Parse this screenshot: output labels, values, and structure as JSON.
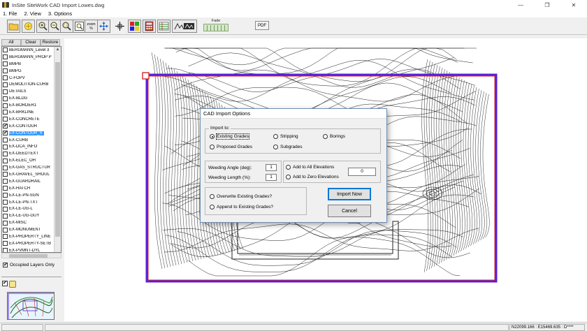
{
  "app": {
    "title": "InSite SiteWork CAD Import   Lowes.dwg",
    "window_controls": [
      "—",
      "❐",
      "✕"
    ]
  },
  "menu": [
    "1. File",
    "2. View",
    "3. Options"
  ],
  "toolbar": {
    "buttons": [
      "open-folder",
      "layers",
      "zoom-in",
      "zoom-out",
      "zoom-window",
      "zoom-extents",
      "zoom-percent",
      "pan",
      "crosshair",
      "palette",
      "calculator",
      "layer-grid",
      "import-site"
    ],
    "zoom_percent_label": "zoom %",
    "fade_label": "Fade",
    "pdf_label": "PDF"
  },
  "layers_panel": {
    "tabs": [
      "All",
      "Clear",
      "Restore"
    ],
    "layers": [
      {
        "name": "BERGMANN_Level 3",
        "checked": false,
        "selected": false
      },
      {
        "name": "BERGMANN_PROP P",
        "checked": false,
        "selected": false
      },
      {
        "name": "BMPB",
        "checked": false,
        "selected": false
      },
      {
        "name": "BMPG",
        "checked": false,
        "selected": false
      },
      {
        "name": "C-FOPV",
        "checked": false,
        "selected": false
      },
      {
        "name": "DEMOLITION-CURB",
        "checked": false,
        "selected": false
      },
      {
        "name": "DETAILS",
        "checked": false,
        "selected": false
      },
      {
        "name": "EX-BLDG",
        "checked": false,
        "selected": false
      },
      {
        "name": "EX-BORDER1",
        "checked": false,
        "selected": false
      },
      {
        "name": "EX-BRKLINE",
        "checked": false,
        "selected": false
      },
      {
        "name": "EX-CONCRETE",
        "checked": false,
        "selected": false
      },
      {
        "name": "EX-CONTOUR",
        "checked": true,
        "selected": false
      },
      {
        "name": "EX-CONTOUR_S",
        "checked": true,
        "selected": true
      },
      {
        "name": "EX-CURB",
        "checked": false,
        "selected": false
      },
      {
        "name": "EX-DCA_INFO",
        "checked": false,
        "selected": false
      },
      {
        "name": "EX-DEEDTEXT",
        "checked": false,
        "selected": false
      },
      {
        "name": "EX-ELEC_OH",
        "checked": false,
        "selected": false
      },
      {
        "name": "EX-GAS_STRUCTUR",
        "checked": false,
        "selected": false
      },
      {
        "name": "EX-GRAVEL_SHOUL",
        "checked": false,
        "selected": false
      },
      {
        "name": "EX-GUARDRAIL",
        "checked": false,
        "selected": false
      },
      {
        "name": "EX-HATCH",
        "checked": false,
        "selected": false
      },
      {
        "name": "EX-LE-PN-SGN",
        "checked": false,
        "selected": false
      },
      {
        "name": "EX-LE-PN-TXT",
        "checked": false,
        "selected": false
      },
      {
        "name": "EX-LE-UG-L",
        "checked": false,
        "selected": false
      },
      {
        "name": "EX-LE-UG-GUY",
        "checked": false,
        "selected": false
      },
      {
        "name": "EX-MISC",
        "checked": false,
        "selected": false
      },
      {
        "name": "EX-MONUMENT",
        "checked": false,
        "selected": false
      },
      {
        "name": "EX-PROPERTY_LINE",
        "checked": false,
        "selected": false
      },
      {
        "name": "EX-PROPERTY-SETB",
        "checked": false,
        "selected": false
      },
      {
        "name": "EX-PVMNT-DYL",
        "checked": false,
        "selected": false
      }
    ],
    "occupied_only_label": "Occupied Layers Only",
    "occupied_only_checked": true
  },
  "dialog": {
    "title": "CAD Import Options",
    "import_to_label": "Import to:",
    "import_options": [
      {
        "label": "Existing Grades",
        "selected": true
      },
      {
        "label": "Stripping",
        "selected": false
      },
      {
        "label": "Borings",
        "selected": false
      },
      {
        "label": "Proposed Grades",
        "selected": false
      },
      {
        "label": "Subgrades",
        "selected": false
      }
    ],
    "weeding_angle_label": "Weeding Angle (deg):",
    "weeding_angle_value": "1",
    "weeding_length_label": "Weeding Length (%):",
    "weeding_length_value": "1",
    "add_all_label": "Add to All Elevations",
    "add_zero_label": "Add to Zero Elevations",
    "add_value": "0",
    "overwrite_label": "Overwrite Existing Grades?",
    "append_label": "Append to Existing Grades?",
    "import_button": "Import Now",
    "cancel_button": "Cancel"
  },
  "status": {
    "coordinates": "N22099.166 : E15469.635 : D****"
  },
  "colors": {
    "border_outer": "#5a1fd6",
    "border_inner": "#d12b2b",
    "selection": "#3399ff",
    "contour": "#1a1a1a"
  }
}
